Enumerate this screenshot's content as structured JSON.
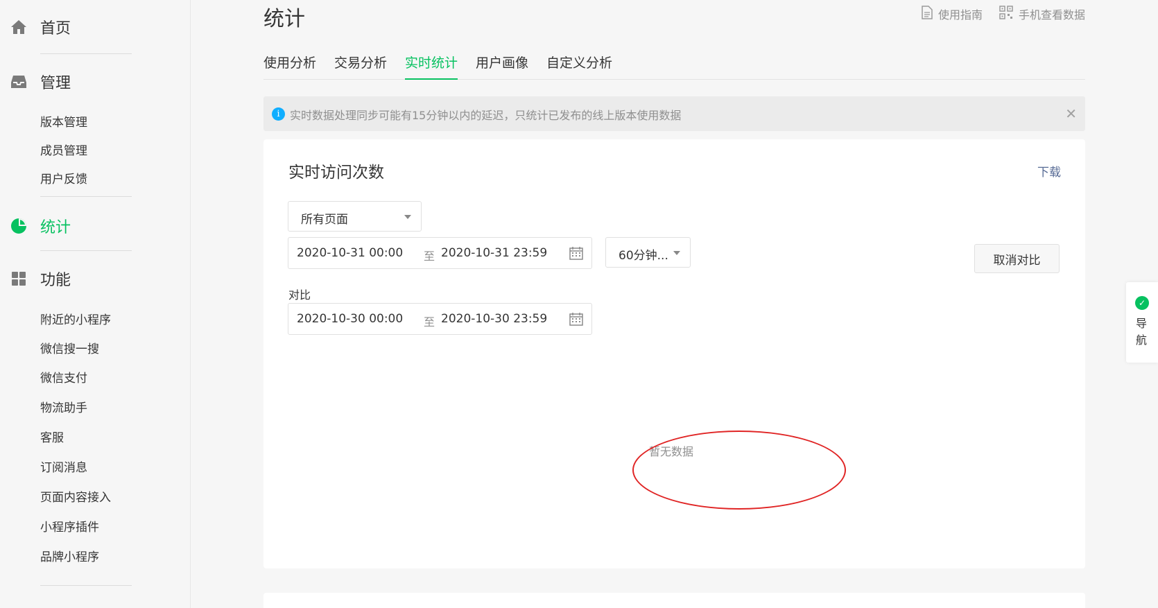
{
  "sidebar": {
    "home": "首页",
    "manage": "管理",
    "manage_items": [
      "版本管理",
      "成员管理",
      "用户反馈"
    ],
    "stats": "统计",
    "features": "功能",
    "feature_items": [
      "附近的小程序",
      "微信搜一搜",
      "微信支付",
      "物流助手",
      "客服",
      "订阅消息",
      "页面内容接入",
      "小程序插件",
      "品牌小程序"
    ]
  },
  "header": {
    "title": "统计",
    "guide": "使用指南",
    "mobile": "手机查看数据"
  },
  "tabs": [
    "使用分析",
    "交易分析",
    "实时统计",
    "用户画像",
    "自定义分析"
  ],
  "notice": {
    "text": "实时数据处理同步可能有15分钟以内的延迟，只统计已发布的线上版本使用数据",
    "info_glyph": "i",
    "close_glyph": "✕"
  },
  "card": {
    "title": "实时访问次数",
    "download": "下载",
    "page_select": "所有页面",
    "range_start": "2020-10-31 00:00",
    "range_sep": "至",
    "range_end": "2020-10-31 23:59",
    "interval_select": "60分钟...",
    "cancel_compare": "取消对比",
    "compare_label": "对比",
    "compare_start": "2020-10-30 00:00",
    "compare_sep": "至",
    "compare_end": "2020-10-30 23:59",
    "no_data": "暂无数据"
  },
  "float_nav": {
    "line1": "导",
    "line2": "航"
  },
  "colors": {
    "accent": "#07c160",
    "link": "#576b95",
    "annotation": "#e02424"
  }
}
